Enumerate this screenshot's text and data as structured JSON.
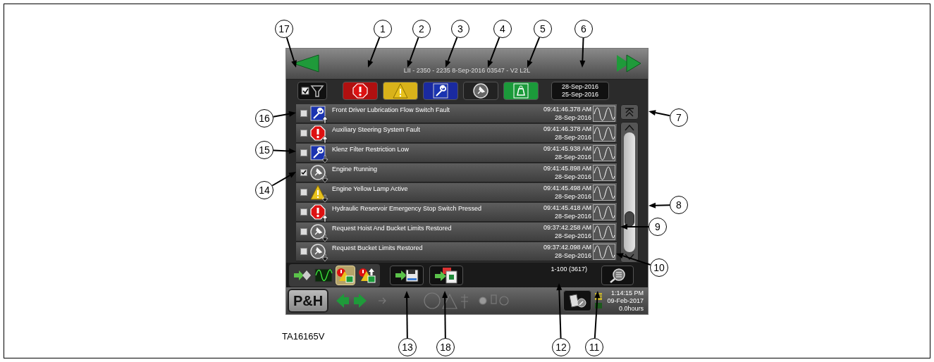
{
  "header": {
    "title": "LII - 2350 - 2235 8-Sep-2016 03547 - V2 L2L"
  },
  "category_filters": [
    {
      "kind": "fault"
    },
    {
      "kind": "warning"
    },
    {
      "kind": "maintenance"
    },
    {
      "kind": "event"
    },
    {
      "kind": "load"
    }
  ],
  "date_range": {
    "end": "28-Sep-2016",
    "start": "25-Sep-2016"
  },
  "events": [
    {
      "kind": "maintenance",
      "arrow_up": true,
      "checked": false,
      "message": "Front Driver Lubrication Flow Switch Fault",
      "time": "09:41:46.378 AM",
      "date": "28-Sep-2016"
    },
    {
      "kind": "fault",
      "arrow_up": true,
      "checked": false,
      "message": "Auxiliary Steering System Fault",
      "time": "09:41:46.378 AM",
      "date": "28-Sep-2016"
    },
    {
      "kind": "maintenance",
      "arrow_up": false,
      "checked": false,
      "message": "Klenz Filter Restriction Low",
      "time": "09:41:45.938 AM",
      "date": "28-Sep-2016"
    },
    {
      "kind": "event",
      "arrow_up": false,
      "checked": true,
      "message": "Engine Running",
      "time": "09:41:45.898 AM",
      "date": "28-Sep-2016"
    },
    {
      "kind": "warning",
      "arrow_up": false,
      "checked": false,
      "message": "Engine Yellow Lamp Active",
      "time": "09:41:45.498 AM",
      "date": "28-Sep-2016"
    },
    {
      "kind": "fault",
      "arrow_up": true,
      "checked": false,
      "message": "Hydraulic Reservoir Emergency Stop Switch Pressed",
      "time": "09:41:45.418 AM",
      "date": "28-Sep-2016"
    },
    {
      "kind": "event",
      "arrow_up": false,
      "checked": false,
      "message": "Request Hoist And Bucket Limits Restored",
      "time": "09:37:42.258 AM",
      "date": "28-Sep-2016"
    },
    {
      "kind": "event",
      "arrow_up": false,
      "checked": false,
      "message": "Request Bucket Limits Restored",
      "time": "09:37:42.098 AM",
      "date": "28-Sep-2016"
    }
  ],
  "view_modes": [
    {
      "kind": "events",
      "selected": false
    },
    {
      "kind": "waveform",
      "selected": false
    },
    {
      "kind": "active",
      "selected": true
    },
    {
      "kind": "history",
      "selected": false
    }
  ],
  "record_count": "1-100 (3617)",
  "status_bar": {
    "logo": "P&H",
    "time": "1:14:15 PM",
    "date": "09-Feb-2017",
    "hours": "0.0hours"
  },
  "caption": "TA16165V",
  "callouts": [
    {
      "number": "17"
    },
    {
      "number": "1"
    },
    {
      "number": "2"
    },
    {
      "number": "3"
    },
    {
      "number": "4"
    },
    {
      "number": "5"
    },
    {
      "number": "6"
    },
    {
      "number": "16"
    },
    {
      "number": "7"
    },
    {
      "number": "15"
    },
    {
      "number": "14"
    },
    {
      "number": "8"
    },
    {
      "number": "9"
    },
    {
      "number": "10"
    },
    {
      "number": "13"
    },
    {
      "number": "18"
    },
    {
      "number": "12"
    },
    {
      "number": "11"
    }
  ]
}
